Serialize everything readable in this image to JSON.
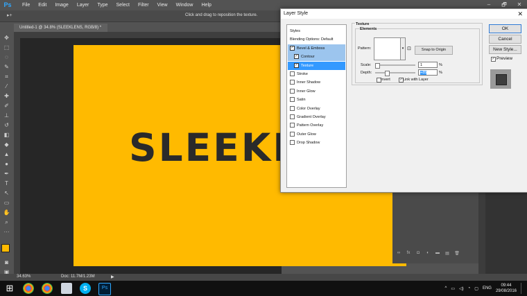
{
  "app": {
    "logo": "Ps",
    "menu": [
      "File",
      "Edit",
      "Image",
      "Layer",
      "Type",
      "Select",
      "Filter",
      "View",
      "Window",
      "Help"
    ],
    "window_controls": [
      "–",
      "🗗",
      "✕"
    ],
    "options_hint": "Click and drag to reposition the texture.",
    "document_tab": "Untitled-1 @ 34.8% (SLEEKLENS, RGB/8) *",
    "document_tab_close": "×",
    "canvas_text": "SLEEKLENS",
    "canvas_color": "#ffba00",
    "zoom": "34.63%",
    "doc_size": "Doc: 11.7M/1.23M"
  },
  "dialog": {
    "title": "Layer Style",
    "close": "✕",
    "styles": [
      {
        "label": "Styles",
        "checkbox": false,
        "state": "header"
      },
      {
        "label": "Blending Options: Default",
        "checkbox": false,
        "state": "normal"
      },
      {
        "label": "Bevel & Emboss",
        "checkbox": true,
        "checked": true,
        "state": "pale"
      },
      {
        "label": "Contour",
        "checkbox": true,
        "checked": true,
        "state": "pale"
      },
      {
        "label": "Texture",
        "checkbox": true,
        "checked": true,
        "state": "selected"
      },
      {
        "label": "Stroke",
        "checkbox": true,
        "checked": false,
        "state": "normal"
      },
      {
        "label": "Inner Shadow",
        "checkbox": true,
        "checked": false,
        "state": "normal"
      },
      {
        "label": "Inner Glow",
        "checkbox": true,
        "checked": false,
        "state": "normal"
      },
      {
        "label": "Satin",
        "checkbox": true,
        "checked": false,
        "state": "normal"
      },
      {
        "label": "Color Overlay",
        "checkbox": true,
        "checked": false,
        "state": "normal"
      },
      {
        "label": "Gradient Overlay",
        "checkbox": true,
        "checked": false,
        "state": "normal"
      },
      {
        "label": "Pattern Overlay",
        "checkbox": true,
        "checked": false,
        "state": "normal"
      },
      {
        "label": "Outer Glow",
        "checkbox": true,
        "checked": false,
        "state": "normal"
      },
      {
        "label": "Drop Shadow",
        "checkbox": true,
        "checked": false,
        "state": "normal"
      }
    ],
    "texture": {
      "section_title": "Texture",
      "subsection": "Elements",
      "pattern_label": "Pattern:",
      "snap_button": "Snap to Origin",
      "scale_label": "Scale:",
      "scale_value": "1",
      "depth_label": "Depth:",
      "depth_value": "+85",
      "unit": "%",
      "invert_label": "Invert",
      "invert_checked": false,
      "link_label": "Link with Layer",
      "link_checked": true
    },
    "buttons": {
      "ok": "OK",
      "cancel": "Cancel",
      "new_style": "New Style...",
      "preview": "Preview",
      "preview_checked": true
    }
  },
  "taskbar": {
    "lang": "ENG",
    "time": "09:44",
    "date": "29/08/2016",
    "tray_arrow": "^"
  }
}
